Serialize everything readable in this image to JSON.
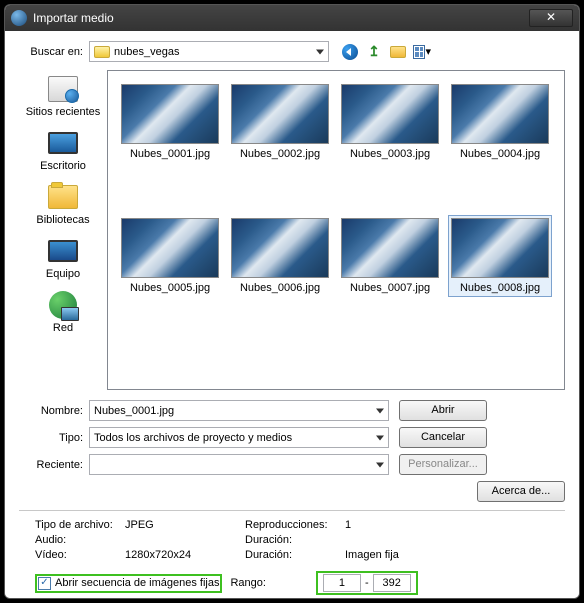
{
  "title": "Importar medio",
  "lookin": {
    "label": "Buscar en:",
    "value": "nubes_vegas"
  },
  "places": {
    "recent": "Sitios recientes",
    "desktop": "Escritorio",
    "libraries": "Bibliotecas",
    "computer": "Equipo",
    "network": "Red"
  },
  "files": [
    {
      "name": "Nubes_0001.jpg"
    },
    {
      "name": "Nubes_0002.jpg"
    },
    {
      "name": "Nubes_0003.jpg"
    },
    {
      "name": "Nubes_0004.jpg"
    },
    {
      "name": "Nubes_0005.jpg"
    },
    {
      "name": "Nubes_0006.jpg"
    },
    {
      "name": "Nubes_0007.jpg"
    },
    {
      "name": "Nubes_0008.jpg"
    }
  ],
  "selected_index": 7,
  "name": {
    "label": "Nombre:",
    "value": "Nubes_0001.jpg"
  },
  "type": {
    "label": "Tipo:",
    "value": "Todos los archivos de proyecto y medios"
  },
  "recent": {
    "label": "Reciente:",
    "value": ""
  },
  "buttons": {
    "open": "Abrir",
    "cancel": "Cancelar",
    "custom": "Personalizar...",
    "about": "Acerca de..."
  },
  "info": {
    "filetype_l": "Tipo de archivo:",
    "filetype_v": "JPEG",
    "plays_l": "Reproducciones:",
    "plays_v": "1",
    "audio_l": "Audio:",
    "audio_v": "",
    "dur1_l": "Duración:",
    "dur1_v": "",
    "video_l": "Vídeo:",
    "video_v": "1280x720x24",
    "dur2_l": "Duración:",
    "dur2_v": "Imagen fija"
  },
  "seq": {
    "label": "Abrir secuencia de imágenes fijas",
    "range_l": "Rango:",
    "from": "1",
    "sep": "-",
    "to": "392"
  }
}
